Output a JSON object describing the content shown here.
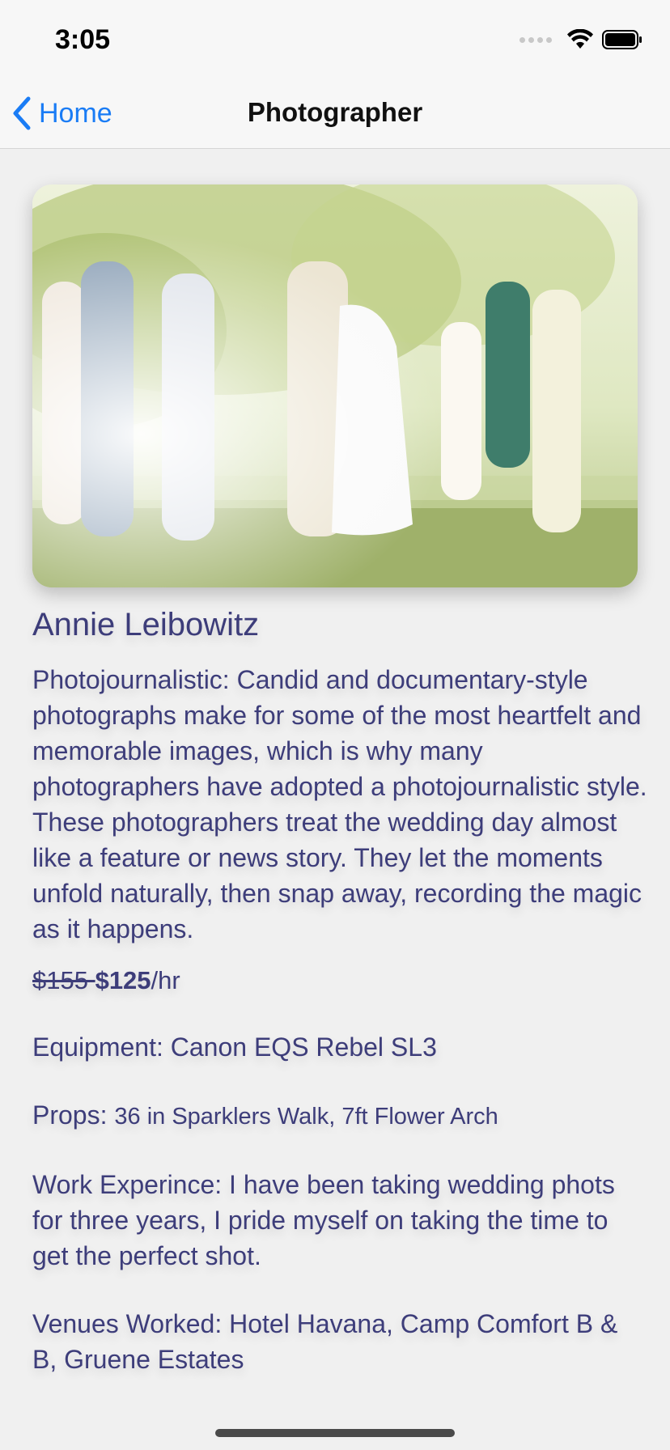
{
  "status_bar": {
    "time": "3:05"
  },
  "nav": {
    "back_label": "Home",
    "title": "Photographer"
  },
  "photographer": {
    "name": "Annie Leibowitz",
    "description": "Photojournalistic: Candid and documentary-style photographs make for some of the most heartfelt and memorable images, which is why many photographers have adopted a photojournalistic style. These photographers treat the wedding day almost like a feature or news story. They let the moments unfold naturally, then snap away, recording the magic as it happens.",
    "old_price": "$155 ",
    "new_price": "$125",
    "price_unit": "/hr",
    "equipment_label": "Equipment: ",
    "equipment_value": "Canon EQS Rebel SL3",
    "props_label": "Props: ",
    "props_value": "36 in Sparklers Walk, 7ft Flower Arch",
    "experience_label": "Work Experince: ",
    "experience_value": "I have been taking wedding phots for three years, I pride myself on taking the time to get the perfect shot.",
    "venues_label": "Venues Worked: ",
    "venues_value": "Hotel Havana, Camp Comfort B & B, Gruene Estates"
  },
  "colors": {
    "accent": "#1a7cf5",
    "text": "#3d3d7a",
    "background": "#f0f0f0"
  },
  "icons": [
    "wifi-icon",
    "battery-icon",
    "chevron-left-icon"
  ]
}
